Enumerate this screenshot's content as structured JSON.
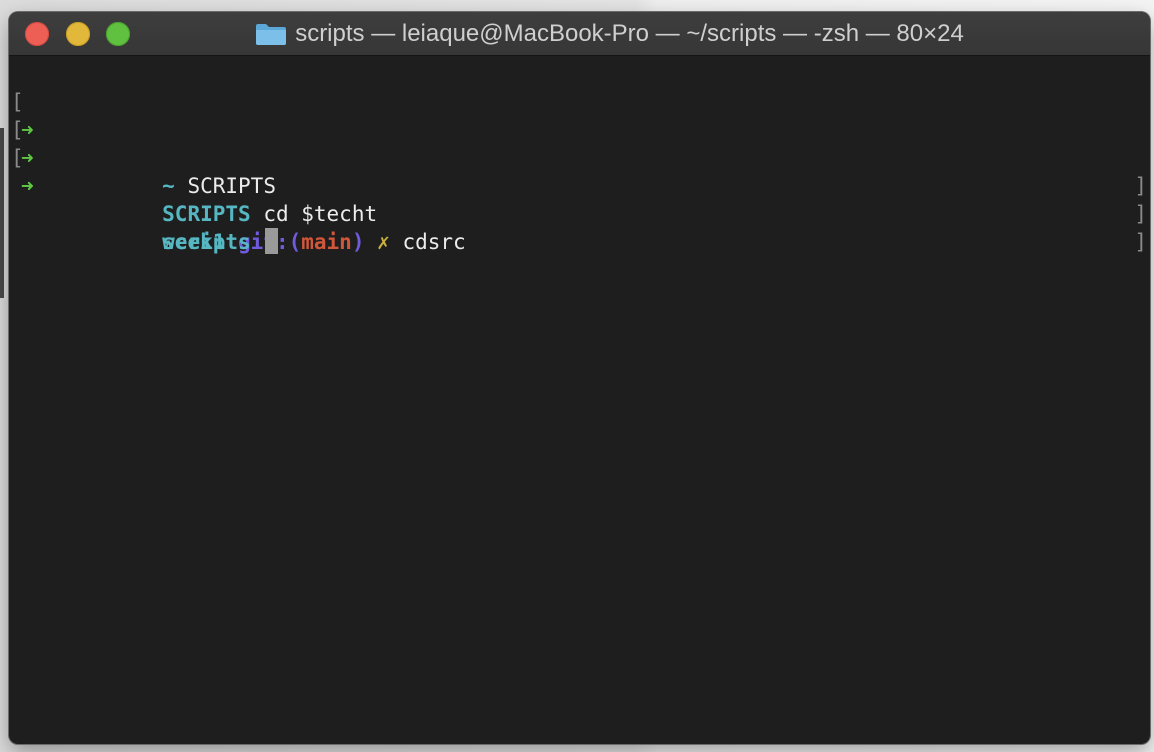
{
  "window": {
    "title": "scripts — leiaque@MacBook-Pro — ~/scripts — -zsh — 80×24",
    "title_icon": "folder-icon",
    "buttons": {
      "close": "close-button",
      "minimize": "minimize-button",
      "maximize": "maximize-button"
    }
  },
  "terminal": {
    "prompt_symbol": "➜",
    "bracket_left": "[",
    "bracket_right": "]",
    "lines": [
      {
        "dir": "~",
        "command": "SCRIPTS"
      },
      {
        "dir": "SCRIPTS",
        "command": "cd $techt"
      },
      {
        "dir": "week1",
        "git_prefix": "git:(",
        "git_branch": "main",
        "git_suffix": ")",
        "dirty_mark": "✗",
        "command": "cdsrc"
      },
      {
        "dir": "scripts",
        "command": ""
      }
    ]
  },
  "colors": {
    "background": "#1e1e1e",
    "arrow": "#5fc744",
    "dir": "#56b6c2",
    "git": "#6f5bdc",
    "branch": "#d1573a",
    "dirty": "#c9b23d",
    "text": "#ececec"
  }
}
